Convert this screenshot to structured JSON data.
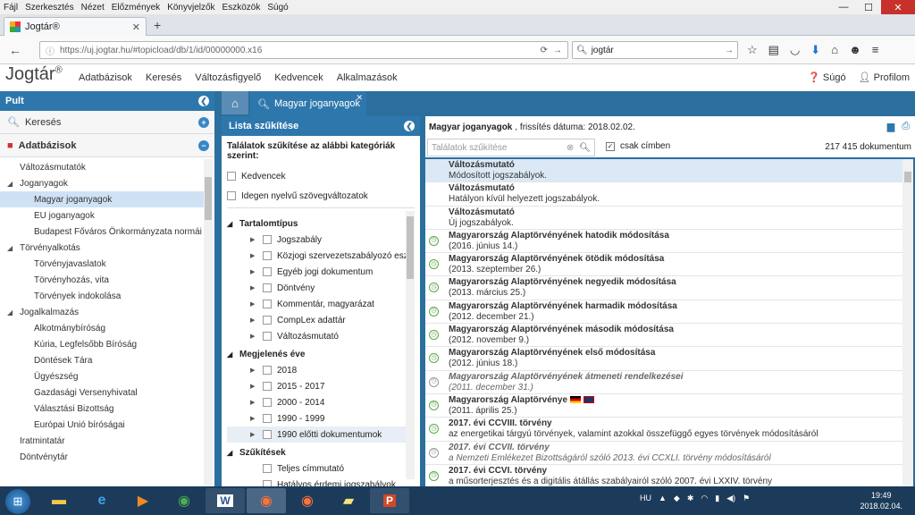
{
  "menu": [
    "Fájl",
    "Szerkesztés",
    "Nézet",
    "Előzmények",
    "Könyvjelzők",
    "Eszközök",
    "Súgó"
  ],
  "browser": {
    "tab_title": "Jogtár®",
    "url": "https://uj.jogtar.hu/#topicload/db/1/id/00000000.x16",
    "search_value": "jogtár"
  },
  "app": {
    "brand": "Jogtár",
    "brand_mark": "®",
    "nav": [
      "Adatbázisok",
      "Keresés",
      "Változásfigyelő",
      "Kedvencek",
      "Alkalmazások"
    ],
    "help": "Súgó",
    "profile": "Profilom"
  },
  "left": {
    "header": "Pult",
    "search": "Keresés",
    "databases": "Adatbázisok",
    "tree": [
      {
        "label": "Változásmutatók",
        "level": "l0e",
        "tw": ""
      },
      {
        "label": "Joganyagok",
        "level": "l0e",
        "tw": "◢"
      },
      {
        "label": "Magyar joganyagok",
        "level": "l1",
        "tw": "",
        "sel": true
      },
      {
        "label": "EU joganyagok",
        "level": "l1",
        "tw": ""
      },
      {
        "label": "Budapest Főváros Önkormányzata normái",
        "level": "l1",
        "tw": ""
      },
      {
        "label": "Törvényalkotás",
        "level": "l0e",
        "tw": "◢"
      },
      {
        "label": "Törvényjavaslatok",
        "level": "l1",
        "tw": ""
      },
      {
        "label": "Törvényhozás, vita",
        "level": "l1",
        "tw": ""
      },
      {
        "label": "Törvények indokolása",
        "level": "l1",
        "tw": ""
      },
      {
        "label": "Jogalkalmazás",
        "level": "l0e",
        "tw": "◢"
      },
      {
        "label": "Alkotmánybíróság",
        "level": "l1",
        "tw": ""
      },
      {
        "label": "Kúria, Legfelsőbb Bíróság",
        "level": "l1",
        "tw": ""
      },
      {
        "label": "Döntések Tára",
        "level": "l1",
        "tw": ""
      },
      {
        "label": "Ügyészség",
        "level": "l1",
        "tw": ""
      },
      {
        "label": "Gazdasági Versenyhivatal",
        "level": "l1",
        "tw": ""
      },
      {
        "label": "Választási Bizottság",
        "level": "l1",
        "tw": ""
      },
      {
        "label": "Európai Unió bíróságai",
        "level": "l1",
        "tw": ""
      },
      {
        "label": "Iratmintatár",
        "level": "l0e",
        "tw": ""
      },
      {
        "label": "Döntvénytár",
        "level": "l0e",
        "tw": ""
      }
    ]
  },
  "tabs": {
    "main_tab": "Magyar joganyagok"
  },
  "middle": {
    "header": "Lista szűkítése",
    "hint": "Találatok szűkítése az alábbi kategóriák szerint:",
    "favorites": "Kedvencek",
    "foreign": "Idegen nyelvű szövegváltozatok",
    "group1": "Tartalomtípus",
    "types": [
      "Jogszabály",
      "Közjogi szervezetszabályozó eszk",
      "Egyéb jogi dokumentum",
      "Döntvény",
      "Kommentár, magyarázat",
      "CompLex adattár",
      "Változásmutató"
    ],
    "group2": "Megjelenés éve",
    "years": [
      "2018",
      "2015 - 2017",
      "2000 - 2014",
      "1990 - 1999",
      "1990 előtti dokumentumok"
    ],
    "group3": "Szűkítések",
    "narrow": [
      "Teljes címmutató",
      "Hatályos érdemi jogszabályok"
    ]
  },
  "right": {
    "title": "Magyar joganyagok",
    "updated": ", frissítés dátuma: 2018.02.02.",
    "search_placeholder": "Találatok szűkítése",
    "only_title": "csak címben",
    "count": "217 415 dokumentum",
    "items": [
      {
        "t": "Változásmutató",
        "s": "Módosított jogszabályok.",
        "icon": "",
        "cls": "sel"
      },
      {
        "t": "Változásmutató",
        "s": "Hatályon kívül helyezett jogszabályok.",
        "icon": "",
        "cls": ""
      },
      {
        "t": "Változásmutató",
        "s": "Új jogszabályok.",
        "icon": "",
        "cls": ""
      },
      {
        "t": "Magyarország Alaptörvényének hatodik módosítása",
        "s": "(2016. június 14.)",
        "icon": "g",
        "cls": ""
      },
      {
        "t": "Magyarország Alaptörvényének ötödik módosítása",
        "s": "(2013. szeptember 26.)",
        "icon": "g",
        "cls": ""
      },
      {
        "t": "Magyarország Alaptörvényének negyedik módosítása",
        "s": "(2013. március 25.)",
        "icon": "g",
        "cls": ""
      },
      {
        "t": "Magyarország Alaptörvényének harmadik módosítása",
        "s": "(2012. december 21.)",
        "icon": "g",
        "cls": ""
      },
      {
        "t": "Magyarország Alaptörvényének második módosítása",
        "s": "(2012. november 9.)",
        "icon": "g",
        "cls": ""
      },
      {
        "t": "Magyarország Alaptörvényének első módosítása",
        "s": "(2012. június 18.)",
        "icon": "g",
        "cls": ""
      },
      {
        "t": "Magyarország Alaptörvényének átmeneti rendelkezései",
        "s": "(2011. december 31.)",
        "icon": "x",
        "cls": "it"
      },
      {
        "t": "Magyarország Alaptörvénye",
        "s": "(2011. április 25.)",
        "icon": "g",
        "cls": "",
        "flags": true
      },
      {
        "t": "2017. évi CCVIII. törvény",
        "s": "az energetikai tárgyú törvények, valamint azokkal összefüggő egyes törvények módosításáról",
        "icon": "g",
        "cls": ""
      },
      {
        "t": "2017. évi CCVII. törvény",
        "s": "a Nemzeti Emlékezet Bizottságáról szóló 2013. évi CCXLI. törvény módosításáról",
        "icon": "x",
        "cls": "it"
      },
      {
        "t": "2017. évi CCVI. törvény",
        "s": "a műsorterjesztés és a digitális átállás szabályairól szóló 2007. évi LXXIV. törvény",
        "icon": "g",
        "cls": ""
      }
    ]
  },
  "tray": {
    "lang": "HU",
    "time": "19:49",
    "date": "2018.02.04."
  }
}
